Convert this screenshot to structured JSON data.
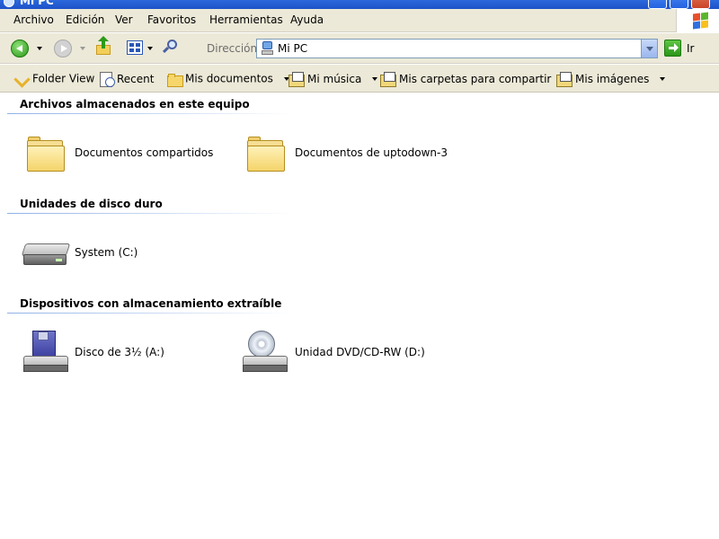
{
  "window": {
    "title": "Mi PC",
    "colors": {
      "titlebar": "#2c69dc",
      "chrome": "#ece9d8",
      "close": "#c94427"
    }
  },
  "menubar": {
    "items": [
      "Archivo",
      "Edición",
      "Ver",
      "Favoritos",
      "Herramientas",
      "Ayuda"
    ]
  },
  "toolbar": {
    "address_label": "Dirección",
    "address_value": "Mi PC",
    "go_label": "Ir"
  },
  "links": [
    {
      "label": "Folder View",
      "icon": "folder-view-icon"
    },
    {
      "label": "Recent",
      "icon": "recent-icon"
    },
    {
      "label": "Mis documentos",
      "icon": "folder-icon"
    },
    {
      "label": "Mi música",
      "icon": "music-folder-icon"
    },
    {
      "label": "Mis carpetas para compartir",
      "icon": "shared-folder-icon"
    },
    {
      "label": "Mis imágenes",
      "icon": "pictures-folder-icon"
    }
  ],
  "groups": [
    {
      "header": "Archivos almacenados en este equipo",
      "items": [
        {
          "label": "Documentos compartidos",
          "icon": "folder-icon"
        },
        {
          "label": "Documentos de uptodown-3",
          "icon": "folder-icon"
        }
      ]
    },
    {
      "header": "Unidades de disco duro",
      "items": [
        {
          "label": "System (C:)",
          "icon": "hard-drive-icon"
        }
      ]
    },
    {
      "header": "Dispositivos con almacenamiento extraíble",
      "items": [
        {
          "label": "Disco de 3½ (A:)",
          "icon": "floppy-drive-icon"
        },
        {
          "label": "Unidad DVD/CD-RW (D:)",
          "icon": "dvd-drive-icon"
        }
      ]
    }
  ]
}
